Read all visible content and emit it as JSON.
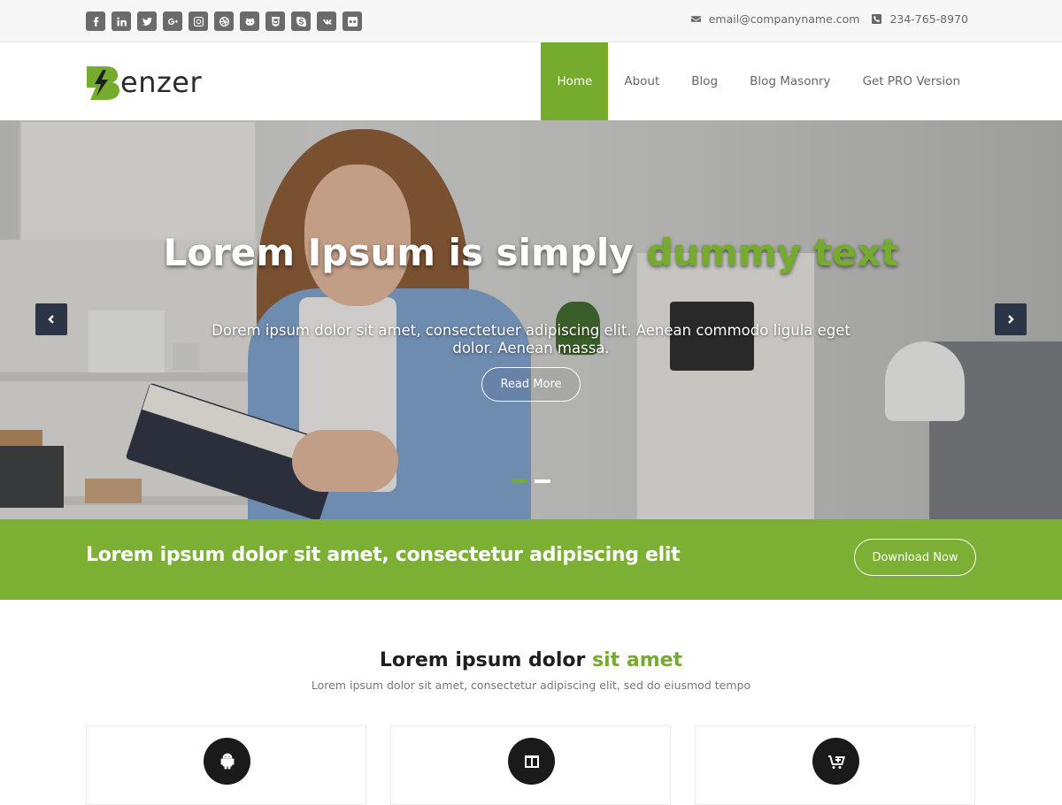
{
  "topbar": {
    "social": [
      "facebook-icon",
      "linkedin-icon",
      "twitter-icon",
      "google-plus-icon",
      "instagram-icon",
      "dribbble-icon",
      "github-icon",
      "html5-icon",
      "skype-icon",
      "vk-icon",
      "flickr-icon"
    ],
    "email": "email@companyname.com",
    "phone": "234-765-8970"
  },
  "header": {
    "logo_text": "enzer",
    "nav": [
      "Home",
      "About",
      "Blog",
      "Blog Masonry",
      "Get PRO Version"
    ],
    "active_nav": "Home"
  },
  "hero": {
    "title_part1": "Lorem Ipsum is simply ",
    "title_highlight": "dummy text",
    "subtitle": "Dorem ipsum dolor sit amet, consectetuer adipiscing elit. Aenean commodo ligula eget dolor. Aenean massa.",
    "button": "Read More",
    "slide_count": 2,
    "active_slide": 1
  },
  "cta": {
    "text": "Lorem ipsum dolor sit amet, consectetur adipiscing elit",
    "button": "Download Now"
  },
  "services": {
    "title_part1": "Lorem ipsum dolor ",
    "title_highlight": "sit amet",
    "subtitle": "Lorem ipsum dolor sit amet, consectetur adipiscing elit, sed do eiusmod tempo",
    "cards": [
      {
        "icon": "android-icon"
      },
      {
        "icon": "columns-icon"
      },
      {
        "icon": "cart-plus-icon"
      }
    ]
  },
  "colors": {
    "accent": "#75ac2e",
    "cta_band": "#7bb035",
    "arrow_bg": "#2b3545",
    "topbar_bg": "#f7f7f7"
  }
}
